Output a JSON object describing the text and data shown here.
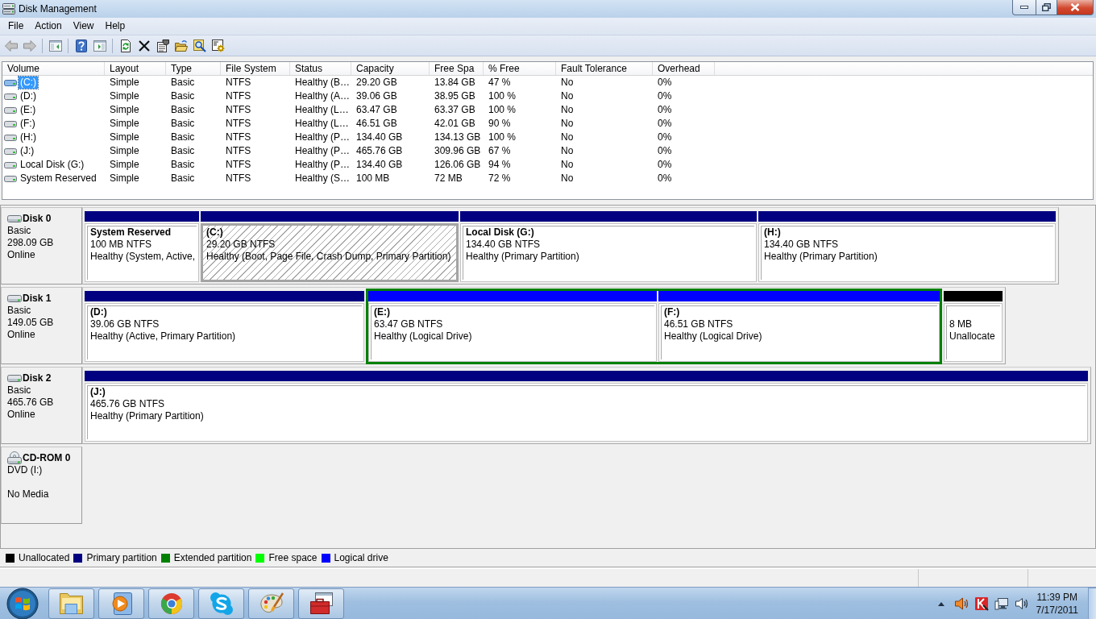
{
  "window": {
    "title": "Disk Management"
  },
  "menu": [
    {
      "label": "File"
    },
    {
      "label": "Action"
    },
    {
      "label": "View"
    },
    {
      "label": "Help"
    }
  ],
  "toolbar": {
    "back": {
      "disabled": true
    },
    "forward": {
      "disabled": true
    }
  },
  "volume_list": {
    "columns": [
      "Volume",
      "Layout",
      "Type",
      "File System",
      "Status",
      "Capacity",
      "Free Spa",
      "% Free",
      "Fault Tolerance",
      "Overhead"
    ],
    "rows": [
      {
        "selected": true,
        "cells": [
          "(C:)",
          "Simple",
          "Basic",
          "NTFS",
          "Healthy (B…",
          "29.20 GB",
          "13.84 GB",
          "47 %",
          "No",
          "0%"
        ]
      },
      {
        "selected": false,
        "cells": [
          "(D:)",
          "Simple",
          "Basic",
          "NTFS",
          "Healthy (A…",
          "39.06 GB",
          "38.95 GB",
          "100 %",
          "No",
          "0%"
        ]
      },
      {
        "selected": false,
        "cells": [
          "(E:)",
          "Simple",
          "Basic",
          "NTFS",
          "Healthy (L…",
          "63.47 GB",
          "63.37 GB",
          "100 %",
          "No",
          "0%"
        ]
      },
      {
        "selected": false,
        "cells": [
          "(F:)",
          "Simple",
          "Basic",
          "NTFS",
          "Healthy (L…",
          "46.51 GB",
          "42.01 GB",
          "90 %",
          "No",
          "0%"
        ]
      },
      {
        "selected": false,
        "cells": [
          "(H:)",
          "Simple",
          "Basic",
          "NTFS",
          "Healthy (P…",
          "134.40 GB",
          "134.13 GB",
          "100 %",
          "No",
          "0%"
        ]
      },
      {
        "selected": false,
        "cells": [
          "(J:)",
          "Simple",
          "Basic",
          "NTFS",
          "Healthy (P…",
          "465.76 GB",
          "309.96 GB",
          "67 %",
          "No",
          "0%"
        ]
      },
      {
        "selected": false,
        "cells": [
          "Local Disk (G:)",
          "Simple",
          "Basic",
          "NTFS",
          "Healthy (P…",
          "134.40 GB",
          "126.06 GB",
          "94 %",
          "No",
          "0%"
        ]
      },
      {
        "selected": false,
        "cells": [
          "System Reserved",
          "Simple",
          "Basic",
          "NTFS",
          "Healthy (S…",
          "100 MB",
          "72 MB",
          "72 %",
          "No",
          "0%"
        ]
      }
    ]
  },
  "disks": [
    {
      "kind": "disk",
      "name": "Disk 0",
      "type": "Basic",
      "size": "298.09 GB",
      "status": "Online",
      "partitions": [
        {
          "kind": "primary",
          "selected": false,
          "label": "System Reserved",
          "detail": "100 MB NTFS",
          "status": "Healthy (System, Active,"
        },
        {
          "kind": "primary",
          "selected": true,
          "label": "(C:)",
          "detail": "29.20 GB NTFS",
          "status": "Healthy (Boot, Page File, Crash Dump, Primary Partition)"
        },
        {
          "kind": "primary",
          "selected": false,
          "label": "Local Disk (G:)",
          "detail": "134.40 GB NTFS",
          "status": "Healthy (Primary Partition)"
        },
        {
          "kind": "primary",
          "selected": false,
          "label": "(H:)",
          "detail": "134.40 GB NTFS",
          "status": "Healthy (Primary Partition)"
        }
      ]
    },
    {
      "kind": "disk",
      "name": "Disk 1",
      "type": "Basic",
      "size": "149.05 GB",
      "status": "Online",
      "partitions": [
        {
          "kind": "primary",
          "selected": false,
          "label": "(D:)",
          "detail": "39.06 GB NTFS",
          "status": "Healthy (Active, Primary Partition)"
        },
        {
          "kind": "extended",
          "selected": false,
          "children": [
            {
              "kind": "logical",
              "selected": false,
              "label": "(E:)",
              "detail": "63.47 GB NTFS",
              "status": "Healthy (Logical Drive)"
            },
            {
              "kind": "logical",
              "selected": false,
              "label": "(F:)",
              "detail": "46.51 GB NTFS",
              "status": "Healthy (Logical Drive)"
            }
          ]
        },
        {
          "kind": "unallocated",
          "selected": false,
          "detail": "8 MB",
          "status": "Unallocate"
        }
      ]
    },
    {
      "kind": "disk",
      "name": "Disk 2",
      "type": "Basic",
      "size": "465.76 GB",
      "status": "Online",
      "partitions": [
        {
          "kind": "primary",
          "selected": false,
          "label": "(J:)",
          "detail": "465.76 GB NTFS",
          "status": "Healthy (Primary Partition)"
        }
      ]
    },
    {
      "kind": "cdrom",
      "name": "CD-ROM 0",
      "type": "DVD (I:)",
      "status": "No Media"
    }
  ],
  "legend": [
    {
      "label": "Unallocated",
      "color": "#000000"
    },
    {
      "label": "Primary partition",
      "color": "#000080"
    },
    {
      "label": "Extended partition",
      "color": "#008000"
    },
    {
      "label": "Free space",
      "color": "#00ff00"
    },
    {
      "label": "Logical drive",
      "color": "#0000ff"
    }
  ],
  "taskbar": {
    "time": "11:39 PM",
    "date": "7/17/2011"
  }
}
